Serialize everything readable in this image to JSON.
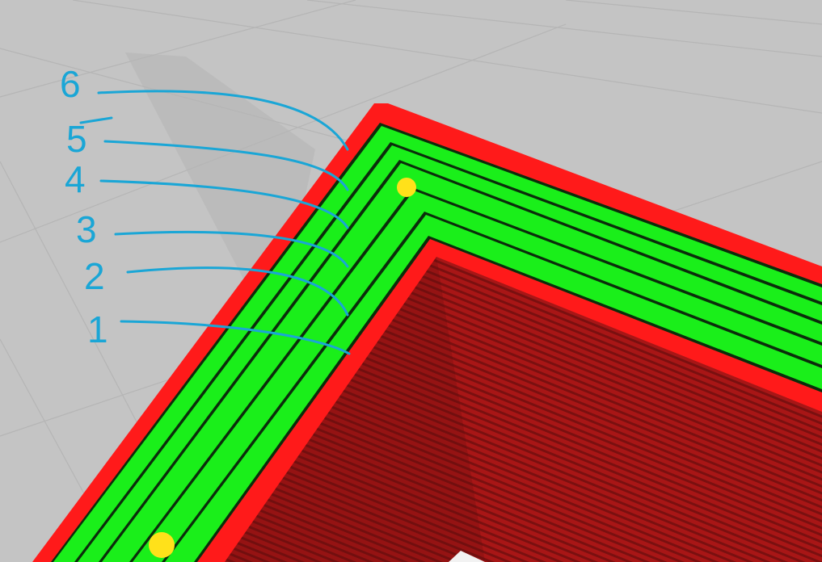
{
  "perimeter_labels": [
    "6",
    "5",
    "4",
    "3",
    "2",
    "1"
  ],
  "colors": {
    "background": "#c4c4c4",
    "grid": "#b3b3b3",
    "outer_wall": "#ff1a1a",
    "inner_wall": "#1aef1a",
    "infill": "#a81616",
    "seam": "#ffe11a",
    "annotation": "#1aa6d6"
  }
}
